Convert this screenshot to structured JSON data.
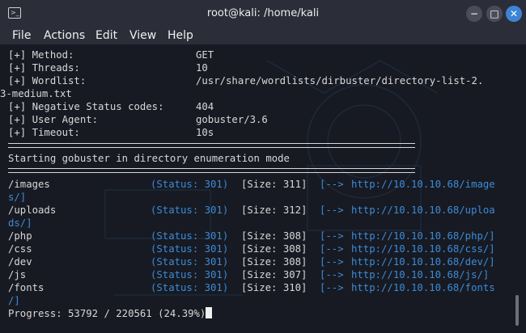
{
  "window": {
    "title": "root@kali: /home/kali"
  },
  "menu": [
    "File",
    "Actions",
    "Edit",
    "View",
    "Help"
  ],
  "config": [
    {
      "label": "[+] Method:",
      "value": "GET"
    },
    {
      "label": "[+] Threads:",
      "value": "10"
    },
    {
      "label": "[+] Wordlist:",
      "value": "/usr/share/wordlists/dirbuster/directory-list-2.",
      "wrap": "3-medium.txt"
    },
    {
      "label": "[+] Negative Status codes:",
      "value": "404"
    },
    {
      "label": "[+] User Agent:",
      "value": "gobuster/3.6"
    },
    {
      "label": "[+] Timeout:",
      "value": "10s"
    }
  ],
  "banner": "Starting gobuster in directory enumeration mode",
  "results": [
    {
      "path": "/images",
      "status": "(Status: 301)",
      "size": "[Size: 311]",
      "arrow": "[-->",
      "url": "http://10.10.10.68/image",
      "wrap": "s/]"
    },
    {
      "path": "/uploads",
      "status": "(Status: 301)",
      "size": "[Size: 312]",
      "arrow": "[-->",
      "url": "http://10.10.10.68/uploa",
      "wrap": "ds/]"
    },
    {
      "path": "/php",
      "status": "(Status: 301)",
      "size": "[Size: 308]",
      "arrow": "[-->",
      "url": "http://10.10.10.68/php/]"
    },
    {
      "path": "/css",
      "status": "(Status: 301)",
      "size": "[Size: 308]",
      "arrow": "[-->",
      "url": "http://10.10.10.68/css/]"
    },
    {
      "path": "/dev",
      "status": "(Status: 301)",
      "size": "[Size: 308]",
      "arrow": "[-->",
      "url": "http://10.10.10.68/dev/]"
    },
    {
      "path": "/js",
      "status": "(Status: 301)",
      "size": "[Size: 307]",
      "arrow": "[-->",
      "url": "http://10.10.10.68/js/]"
    },
    {
      "path": "/fonts",
      "status": "(Status: 301)",
      "size": "[Size: 310]",
      "arrow": "[-->",
      "url": "http://10.10.10.68/fonts",
      "wrap": "/]"
    }
  ],
  "progress": "Progress: 53792 / 220561 (24.39%)",
  "colors": {
    "accent": "#3c8bd9",
    "close_button": "#3d84d6",
    "background": "#171a22"
  },
  "icons": [
    "terminal-icon",
    "minimize-icon",
    "maximize-icon",
    "close-icon"
  ]
}
